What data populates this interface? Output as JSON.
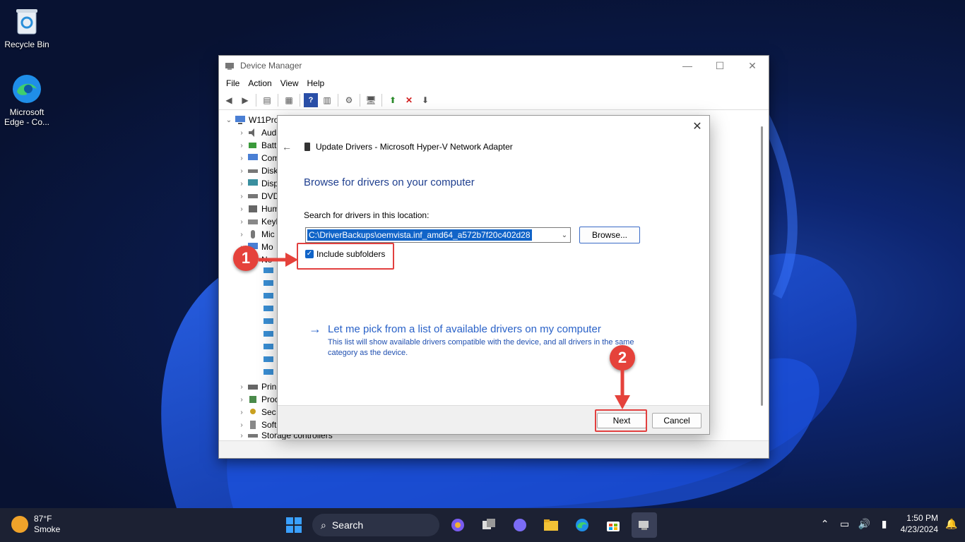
{
  "desktop": {
    "icons": [
      {
        "label": "Recycle Bin"
      },
      {
        "label": "Microsoft Edge - Co..."
      }
    ]
  },
  "device_manager": {
    "title": "Device Manager",
    "menu": [
      "File",
      "Action",
      "View",
      "Help"
    ],
    "tree": {
      "root": "W11Pro",
      "items": [
        "Audi",
        "Batt",
        "Com",
        "Disk",
        "Disp",
        "DVD",
        "Hum",
        "Keyb",
        "Mic",
        "Mo",
        "Ne",
        "Prin",
        "Proc",
        "Sec",
        "Soft",
        "Storage controllers"
      ]
    }
  },
  "update_drivers": {
    "title": "Update Drivers - Microsoft Hyper-V Network Adapter",
    "heading": "Browse for drivers on your computer",
    "search_label": "Search for drivers in this location:",
    "path_value": "C:\\DriverBackups\\oemvista.inf_amd64_a572b7f20c402d28",
    "browse_label": "Browse...",
    "include_subfolders_label": "Include subfolders",
    "include_subfolders_checked": true,
    "pick_link": "Let me pick from a list of available drivers on my computer",
    "pick_desc": "This list will show available drivers compatible with the device, and all drivers in the same category as the device.",
    "next_label": "Next",
    "cancel_label": "Cancel"
  },
  "annotations": {
    "step1": "1",
    "step2": "2",
    "highlight_color": "#e2403f"
  },
  "taskbar": {
    "weather_temp": "87°F",
    "weather_desc": "Smoke",
    "search_placeholder": "Search",
    "time": "1:50 PM",
    "date": "4/23/2024"
  },
  "colors": {
    "accent": "#1164c8",
    "link": "#2a62c8",
    "annotation": "#e5423b"
  }
}
